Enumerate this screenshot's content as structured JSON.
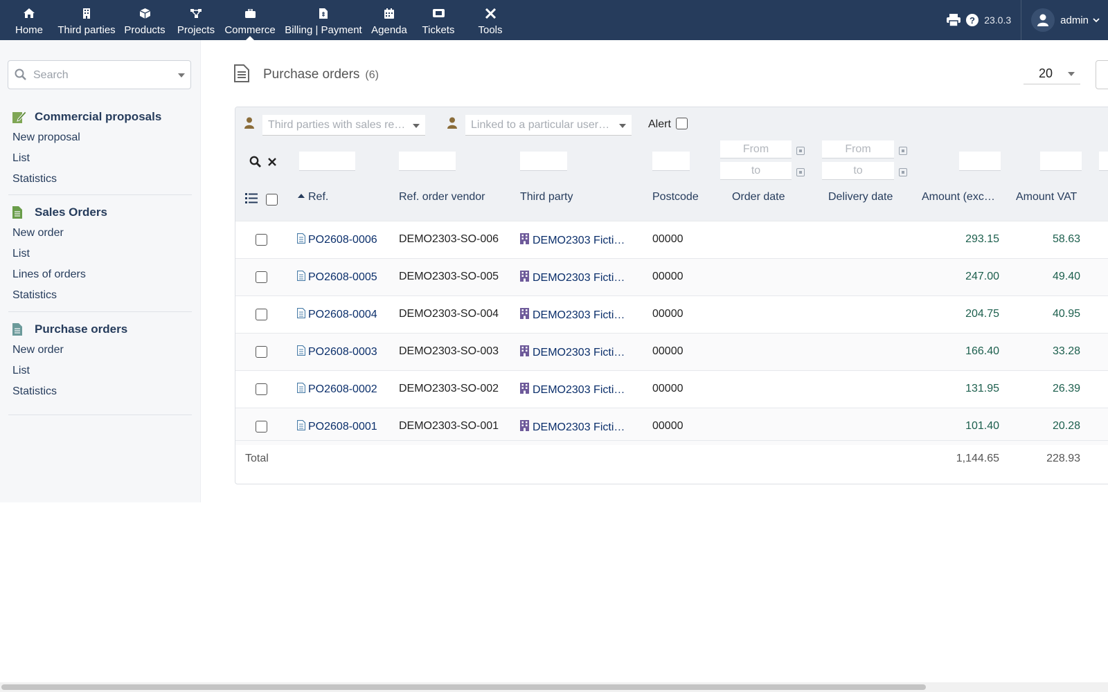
{
  "topmenu": {
    "items": [
      {
        "label": "Home",
        "icon": "home-icon"
      },
      {
        "label": "Third parties",
        "icon": "building-icon"
      },
      {
        "label": "Products",
        "icon": "cube-icon"
      },
      {
        "label": "Projects",
        "icon": "project-icon"
      },
      {
        "label": "Commerce",
        "icon": "briefcase-icon",
        "active": true
      },
      {
        "label": "Billing | Payment",
        "icon": "invoice-icon"
      },
      {
        "label": "Agenda",
        "icon": "calendar-icon"
      },
      {
        "label": "Tickets",
        "icon": "ticket-icon"
      },
      {
        "label": "Tools",
        "icon": "tools-icon"
      }
    ],
    "version": "23.0.3",
    "user": "admin"
  },
  "leftmenu": {
    "search_placeholder": "Search",
    "sections": [
      {
        "title": "Commercial proposals",
        "items": [
          "New proposal",
          "List",
          "Statistics"
        ]
      },
      {
        "title": "Sales Orders",
        "items": [
          "New order",
          "List",
          "Lines of orders",
          "Statistics"
        ]
      },
      {
        "title": "Purchase orders",
        "items": [
          "New order",
          "List",
          "Statistics"
        ]
      }
    ]
  },
  "page": {
    "title": "Purchase orders",
    "count": "(6)",
    "limit": "20"
  },
  "filters": {
    "sales_rep_placeholder": "Third parties with sales re…",
    "linked_user_placeholder": "Linked to a particular user…",
    "alert_label": "Alert",
    "order_date_from": "From",
    "order_date_to": "to",
    "delivery_date_from": "From",
    "delivery_date_to": "to"
  },
  "table": {
    "headers": {
      "ref": "Ref.",
      "ref_vendor": "Ref. order vendor",
      "third_party": "Third party",
      "postcode": "Postcode",
      "order_date": "Order date",
      "delivery_date": "Delivery date",
      "amount_excl": "Amount (exc…",
      "amount_vat": "Amount VAT"
    },
    "rows": [
      {
        "ref": "PO2608-0006",
        "ref_vendor": "DEMO2303-SO-006",
        "third_party": "DEMO2303 Ficti…",
        "postcode": "00000",
        "amount_excl": "293.15",
        "amount_vat": "58.63"
      },
      {
        "ref": "PO2608-0005",
        "ref_vendor": "DEMO2303-SO-005",
        "third_party": "DEMO2303 Ficti…",
        "postcode": "00000",
        "amount_excl": "247.00",
        "amount_vat": "49.40"
      },
      {
        "ref": "PO2608-0004",
        "ref_vendor": "DEMO2303-SO-004",
        "third_party": "DEMO2303 Ficti…",
        "postcode": "00000",
        "amount_excl": "204.75",
        "amount_vat": "40.95"
      },
      {
        "ref": "PO2608-0003",
        "ref_vendor": "DEMO2303-SO-003",
        "third_party": "DEMO2303 Ficti…",
        "postcode": "00000",
        "amount_excl": "166.40",
        "amount_vat": "33.28"
      },
      {
        "ref": "PO2608-0002",
        "ref_vendor": "DEMO2303-SO-002",
        "third_party": "DEMO2303 Ficti…",
        "postcode": "00000",
        "amount_excl": "131.95",
        "amount_vat": "26.39"
      },
      {
        "ref": "PO2608-0001",
        "ref_vendor": "DEMO2303-SO-001",
        "third_party": "DEMO2303 Ficti…",
        "postcode": "00000",
        "amount_excl": "101.40",
        "amount_vat": "20.28"
      }
    ],
    "total": {
      "label": "Total",
      "amount_excl": "1,144.65",
      "amount_vat": "228.93"
    }
  },
  "colors": {
    "topbar": "#263c5c",
    "link": "#0b2f6b",
    "amount": "#1c5f4d"
  }
}
